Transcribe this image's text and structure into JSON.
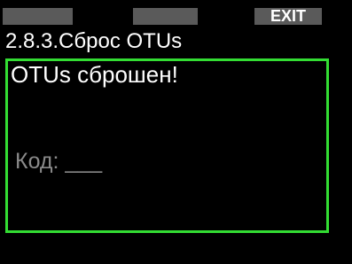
{
  "softkeys": {
    "left": "",
    "middle": "",
    "right": "EXIT"
  },
  "title": "2.8.3.Сброс OTUs",
  "message": "OTUs сброшен!",
  "code_label": "Код: ___",
  "colors": {
    "background": "#000000",
    "softkey_bg": "#5a5a5a",
    "panel_border": "#33dd33",
    "code_text": "#8a8a8a"
  }
}
